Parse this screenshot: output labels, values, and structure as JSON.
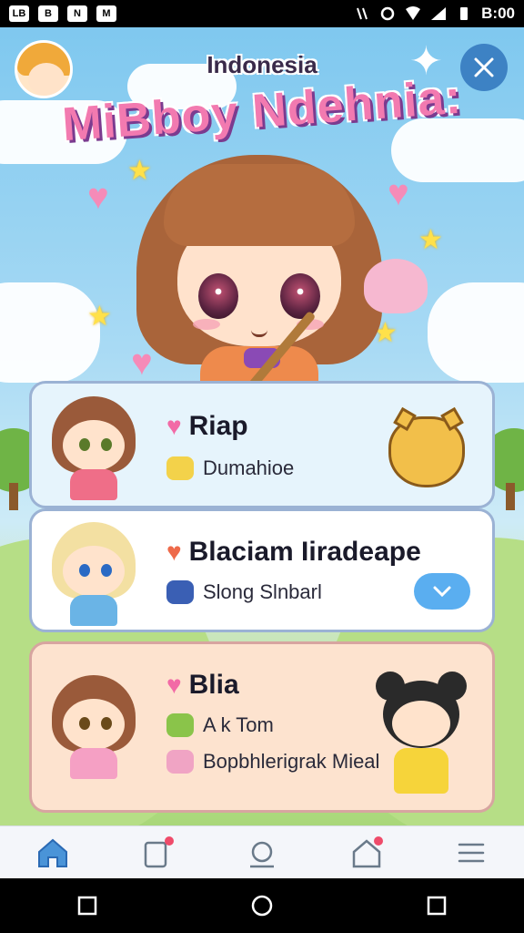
{
  "status_bar": {
    "left_icons": [
      "LB",
      "B",
      "N",
      "M"
    ],
    "time": "B:00"
  },
  "header": {
    "region": "Indonesia",
    "app_title": "MiBboy Ndehnia:"
  },
  "cards": [
    {
      "title": "Riap",
      "subtitle": "Dumahioe"
    },
    {
      "title": "Blaciam Iiradeape",
      "subtitle": "Slong Slnbarl",
      "action_icon": "chevron-down-icon"
    },
    {
      "title": "Blia",
      "subtitle": "A k Tom",
      "extra": "Bopbhlerigrak Mieal"
    }
  ],
  "bottom_nav": [
    "home-icon",
    "notes-icon",
    "search-icon",
    "house-icon",
    "menu-icon"
  ],
  "colors": {
    "accent": "#3d82c4",
    "title_pink": "#f27ab0",
    "notification": "#ef4b6a"
  }
}
